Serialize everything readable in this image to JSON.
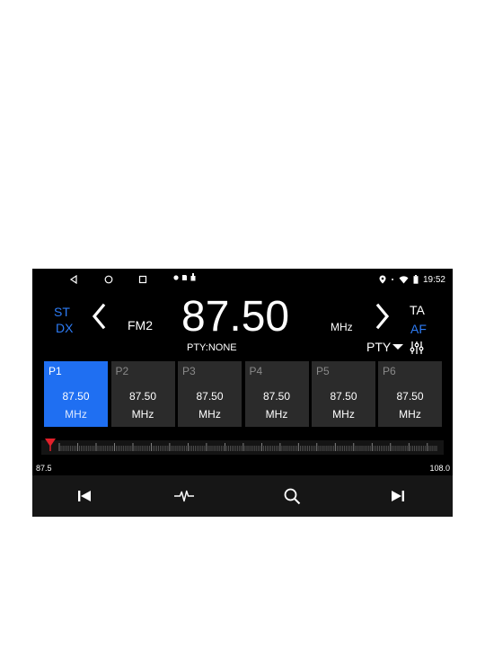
{
  "status": {
    "time": "19:52"
  },
  "nav": {
    "back_icon": "back-triangle-icon",
    "home_icon": "home-circle-icon",
    "recents_icon": "recents-square-icon"
  },
  "radio": {
    "st_label": "ST",
    "dx_label": "DX",
    "band": "FM2",
    "frequency": "87.50",
    "unit": "MHz",
    "pty_status": "PTY:NONE",
    "ta_label": "TA",
    "af_label": "AF",
    "pty_select": "PTY"
  },
  "presets": [
    {
      "name": "P1",
      "freq": "87.50",
      "unit": "MHz",
      "active": true
    },
    {
      "name": "P2",
      "freq": "87.50",
      "unit": "MHz",
      "active": false
    },
    {
      "name": "P3",
      "freq": "87.50",
      "unit": "MHz",
      "active": false
    },
    {
      "name": "P4",
      "freq": "87.50",
      "unit": "MHz",
      "active": false
    },
    {
      "name": "P5",
      "freq": "87.50",
      "unit": "MHz",
      "active": false
    },
    {
      "name": "P6",
      "freq": "87.50",
      "unit": "MHz",
      "active": false
    }
  ],
  "dial": {
    "min_label": "87.5",
    "max_label": "108.0",
    "min_value": 87.5,
    "max_value": 108.0,
    "current_value": 87.5
  },
  "colors": {
    "accent": "#2d7cf6",
    "active_preset": "#1f6ff2",
    "marker": "#e2202a"
  }
}
